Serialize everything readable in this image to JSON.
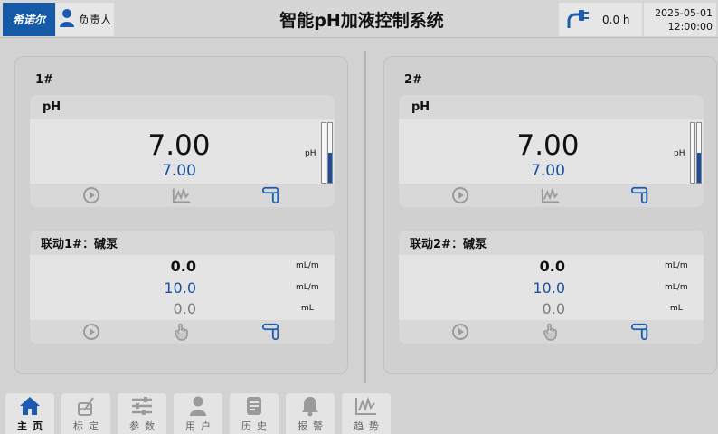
{
  "header": {
    "logo_text": "希诺尔",
    "user_label": "负责人",
    "title": "智能pH加液控制系统",
    "runtime": "0.0 h",
    "date": "2025-05-01",
    "time": "12:00:00"
  },
  "channels": [
    {
      "title": "1#",
      "ph_label": "pH",
      "ph_value": "7.00",
      "ph_setpoint": "7.00",
      "ph_unit": "pH",
      "bar_levels": [
        0,
        0.5
      ],
      "pump_title": "联动1#：碱泵",
      "pump_rate": "0.0",
      "pump_rate_unit": "mL/m",
      "pump_set_rate": "10.0",
      "pump_set_rate_unit": "mL/m",
      "pump_total": "0.0",
      "pump_total_unit": "mL"
    },
    {
      "title": "2#",
      "ph_label": "pH",
      "ph_value": "7.00",
      "ph_setpoint": "7.00",
      "ph_unit": "pH",
      "bar_levels": [
        0,
        0.5
      ],
      "pump_title": "联动2#：碱泵",
      "pump_rate": "0.0",
      "pump_rate_unit": "mL/m",
      "pump_set_rate": "10.0",
      "pump_set_rate_unit": "mL/m",
      "pump_total": "0.0",
      "pump_total_unit": "mL"
    }
  ],
  "nav": [
    {
      "label": "主页",
      "icon": "home-icon",
      "active": true
    },
    {
      "label": "标定",
      "icon": "calibrate-icon",
      "active": false
    },
    {
      "label": "参数",
      "icon": "sliders-icon",
      "active": false
    },
    {
      "label": "用户",
      "icon": "user-icon",
      "active": false
    },
    {
      "label": "历史",
      "icon": "history-icon",
      "active": false
    },
    {
      "label": "报警",
      "icon": "bell-icon",
      "active": false
    },
    {
      "label": "趋势",
      "icon": "trend-icon",
      "active": false
    }
  ],
  "colors": {
    "accent": "#1a4fa0",
    "logo_bg": "#1559a9",
    "nav_active": "#1d5bb0",
    "icon_grey": "#9a9a9a"
  }
}
